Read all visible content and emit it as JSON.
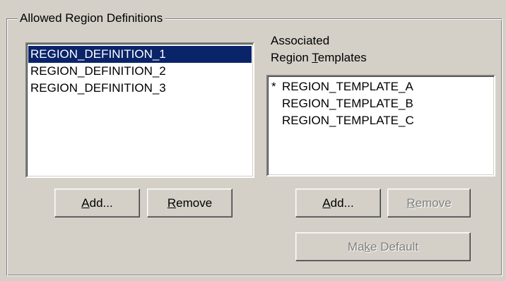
{
  "group": {
    "title": "Allowed Region Definitions"
  },
  "definitions": {
    "items": [
      {
        "label": "REGION_DEFINITION_1",
        "selected": true
      },
      {
        "label": "REGION_DEFINITION_2",
        "selected": false
      },
      {
        "label": "REGION_DEFINITION_3",
        "selected": false
      }
    ],
    "add_button": {
      "pre": "",
      "mnemonic": "A",
      "post": "dd..."
    },
    "remove_button": {
      "pre": "",
      "mnemonic": "R",
      "post": "emove"
    }
  },
  "templates": {
    "label_line1": "Associated",
    "label_line2": {
      "pre": "Region ",
      "mnemonic": "T",
      "post": "emplates"
    },
    "default_marker": "*",
    "items": [
      {
        "label": "REGION_TEMPLATE_A",
        "is_default": true
      },
      {
        "label": "REGION_TEMPLATE_B",
        "is_default": false
      },
      {
        "label": "REGION_TEMPLATE_C",
        "is_default": false
      }
    ],
    "add_button": {
      "pre": "",
      "mnemonic": "A",
      "post": "dd...",
      "enabled": true
    },
    "remove_button": {
      "pre": "",
      "mnemonic": "R",
      "post": "emove",
      "enabled": false
    },
    "make_default_button": {
      "pre": "Ma",
      "mnemonic": "k",
      "post": "e Default",
      "enabled": false
    }
  },
  "colors": {
    "background": "#d4d0c8",
    "selection": "#0a246a",
    "disabled_text": "#808080"
  }
}
